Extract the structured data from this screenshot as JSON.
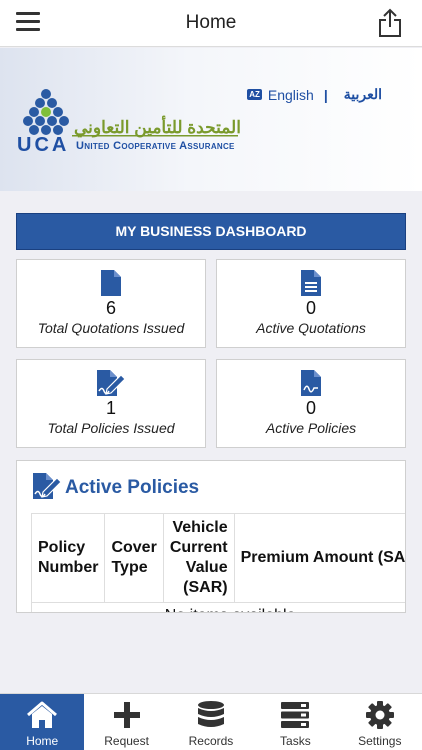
{
  "header": {
    "title": "Home"
  },
  "banner": {
    "lang_english": "English",
    "lang_arabic": "العربية",
    "lang_icon_text": "AZ",
    "logo_arabic": "المتحدة للتأمين التعاوني",
    "logo_short": "UCA",
    "logo_english": "United Cooperative Assurance"
  },
  "dashboard": {
    "title": "MY BUSINESS DASHBOARD",
    "cards": [
      {
        "value": "6",
        "label": "Total Quotations Issued",
        "icon": "document-icon"
      },
      {
        "value": "0",
        "label": "Active Quotations",
        "icon": "document-lines-icon"
      },
      {
        "value": "1",
        "label": "Total Policies Issued",
        "icon": "signed-document-icon"
      },
      {
        "value": "0",
        "label": "Active Policies",
        "icon": "signature-document-icon"
      }
    ]
  },
  "active_policies": {
    "title": "Active Policies",
    "columns": [
      "Policy Number",
      "Cover Type",
      "Vehicle Current Value (SAR)",
      "Premium Amount (SAR)"
    ],
    "empty_text": "No items available"
  },
  "tabs": [
    {
      "label": "Home",
      "icon": "home-icon",
      "active": true
    },
    {
      "label": "Request",
      "icon": "plus-icon",
      "active": false
    },
    {
      "label": "Records",
      "icon": "database-icon",
      "active": false
    },
    {
      "label": "Tasks",
      "icon": "tasks-icon",
      "active": false
    },
    {
      "label": "Settings",
      "icon": "gear-icon",
      "active": false
    }
  ],
  "colors": {
    "brand": "#2a5aa3",
    "logo_green": "#7a9a2c"
  }
}
